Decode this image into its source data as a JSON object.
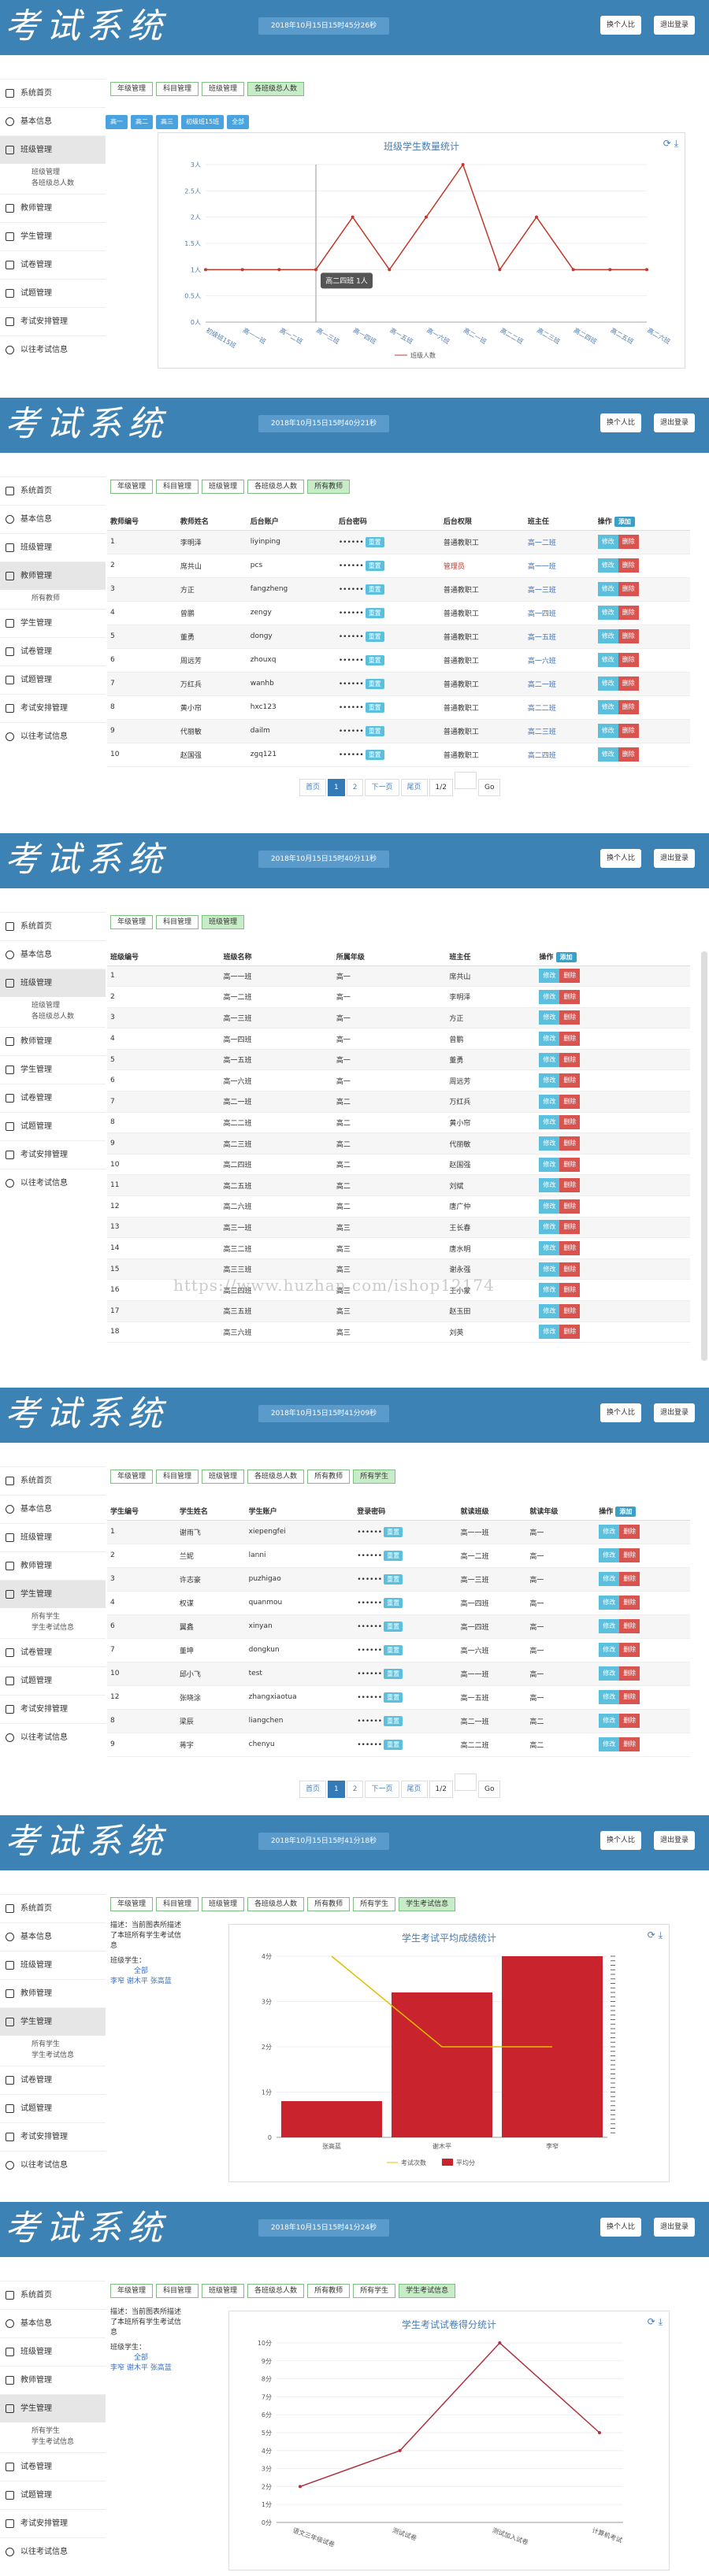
{
  "header": {
    "logo": "考试系统",
    "btn_switch": "换个人比",
    "btn_logout": "退出登录"
  },
  "dates": [
    "2018年10月15日15时45分26秒",
    "2018年10月15日15时40分21秒",
    "2018年10月15日15时40分11秒",
    "2018年10月15日15时41分09秒",
    "2018年10月15日15时41分18秒",
    "2018年10月15日15时41分24秒"
  ],
  "nav": [
    "系统首页",
    "基本信息",
    "班级管理",
    "教师管理",
    "学生管理",
    "试卷管理",
    "试题管理",
    "考试安排管理",
    "以往考试信息"
  ],
  "sub": {
    "class": [
      "班级管理",
      "各班级总人数"
    ],
    "teacher": [
      "所有教师"
    ],
    "student": [
      "所有学生",
      "学生考试信息"
    ]
  },
  "tabs": {
    "p1": [
      "年级管理",
      "科目管理",
      "班级管理",
      "各班级总人数"
    ],
    "p2": [
      "年级管理",
      "科目管理",
      "班级管理",
      "各班级总人数",
      "所有教师"
    ],
    "p3": [
      "年级管理",
      "科目管理",
      "班级管理"
    ],
    "p4": [
      "年级管理",
      "科目管理",
      "班级管理",
      "各班级总人数",
      "所有教师",
      "所有学生"
    ],
    "p5": [
      "年级管理",
      "科目管理",
      "班级管理",
      "各班级总人数",
      "所有教师",
      "所有学生",
      "学生考试信息"
    ]
  },
  "p1": {
    "subtabs": [
      "高一",
      "高二",
      "高三",
      "初级班15班",
      "全部"
    ],
    "tooltip": "高二四班 1人"
  },
  "actions": {
    "add": "添加",
    "edit": "修改",
    "del": "删除",
    "reset": "重置",
    "dots": "••••••"
  },
  "teachers": {
    "headers": [
      "教师编号",
      "教师姓名",
      "后台账户",
      "后台密码",
      "后台权限",
      "班主任",
      "操作"
    ],
    "rows": [
      [
        "1",
        "李明泽",
        "liyinping",
        "普通教职工",
        "高一二班"
      ],
      [
        "2",
        "席共山",
        "pcs",
        "管理员",
        "高一一班"
      ],
      [
        "3",
        "方正",
        "fangzheng",
        "普通教职工",
        "高一三班"
      ],
      [
        "4",
        "曾鹏",
        "zengy",
        "普通教职工",
        "高一四班"
      ],
      [
        "5",
        "董勇",
        "dongy",
        "普通教职工",
        "高一五班"
      ],
      [
        "6",
        "周远芳",
        "zhouxq",
        "普通教职工",
        "高一六班"
      ],
      [
        "7",
        "万红兵",
        "wanhb",
        "普通教职工",
        "高二一班"
      ],
      [
        "8",
        "黄小帘",
        "hxc123",
        "普通教职工",
        "高二二班"
      ],
      [
        "9",
        "代丽敏",
        "dailm",
        "普通教职工",
        "高二三班"
      ],
      [
        "10",
        "赵国强",
        "zgq121",
        "普通教职工",
        "高二四班"
      ]
    ]
  },
  "pager": {
    "first": "首页",
    "p1": "1",
    "p2": "2",
    "next": "下一页",
    "last": "尾页",
    "count": "1/2",
    "go": "Go"
  },
  "classes": {
    "headers": [
      "班级编号",
      "班级名称",
      "所属年级",
      "班主任",
      "操作"
    ],
    "rows": [
      [
        "1",
        "高一一班",
        "高一",
        "席共山"
      ],
      [
        "2",
        "高一二班",
        "高一",
        "李明泽"
      ],
      [
        "3",
        "高一三班",
        "高一",
        "方正"
      ],
      [
        "4",
        "高一四班",
        "高一",
        "曾鹏"
      ],
      [
        "5",
        "高一五班",
        "高一",
        "董勇"
      ],
      [
        "6",
        "高一六班",
        "高一",
        "周远芳"
      ],
      [
        "7",
        "高二一班",
        "高二",
        "万红兵"
      ],
      [
        "8",
        "高二二班",
        "高二",
        "黄小帘"
      ],
      [
        "9",
        "高二三班",
        "高二",
        "代丽敏"
      ],
      [
        "10",
        "高二四班",
        "高二",
        "赵国强"
      ],
      [
        "11",
        "高二五班",
        "高二",
        "刘斌"
      ],
      [
        "12",
        "高二六班",
        "高二",
        "唐广仲"
      ],
      [
        "13",
        "高三一班",
        "高三",
        "王长春"
      ],
      [
        "14",
        "高三二班",
        "高三",
        "唐水明"
      ],
      [
        "15",
        "高三三班",
        "高三",
        "谢永强"
      ],
      [
        "16",
        "高三四班",
        "高三",
        "王小蒙"
      ],
      [
        "17",
        "高三五班",
        "高三",
        "赵玉田"
      ],
      [
        "18",
        "高三六班",
        "高三",
        "刘英"
      ]
    ]
  },
  "students": {
    "headers": [
      "学生编号",
      "学生姓名",
      "学生账户",
      "登录密码",
      "就读班级",
      "就读年级",
      "操作"
    ],
    "rows": [
      [
        "1",
        "谢雨飞",
        "xiepengfei",
        "高一一班",
        "高一"
      ],
      [
        "2",
        "兰妮",
        "lanni",
        "高一二班",
        "高一"
      ],
      [
        "3",
        "许志豪",
        "puzhigao",
        "高一三班",
        "高一"
      ],
      [
        "4",
        "权谋",
        "quanmou",
        "高一四班",
        "高一"
      ],
      [
        "6",
        "翼鑫",
        "xinyan",
        "高一四班",
        "高一"
      ],
      [
        "7",
        "董坤",
        "dongkun",
        "高一六班",
        "高一"
      ],
      [
        "10",
        "邱小飞",
        "test",
        "高一一班",
        "高一"
      ],
      [
        "12",
        "张晓涂",
        "zhangxiaotua",
        "高一五班",
        "高一"
      ],
      [
        "8",
        "梁辰",
        "liangchen",
        "高二一班",
        "高二"
      ],
      [
        "9",
        "蒋宇",
        "chenyu",
        "高二二班",
        "高二"
      ]
    ]
  },
  "exam_info": {
    "desc": "描述：当前图表所描述了本班所有学生考试信息",
    "cls_label": "班级学生：",
    "all": "全部",
    "names": [
      "李窄",
      "谢木平",
      "张高蓝"
    ]
  },
  "watermark": "https://www.huzhan.com/ishop12174",
  "chart_data": [
    {
      "type": "line",
      "title": "班级学生数量统计",
      "legend": "班级人数",
      "categories": [
        "初级班15班",
        "高一一班",
        "高一二班",
        "高一三班",
        "高一四班",
        "高一五班",
        "高一六班",
        "高二一班",
        "高二二班",
        "高二三班",
        "高二四班",
        "高二五班",
        "高二六班"
      ],
      "values": [
        1,
        1,
        1,
        1,
        2,
        1,
        2,
        3,
        1,
        2,
        1,
        1,
        1
      ],
      "yticks": [
        "0人",
        "0.5人",
        "1人",
        "1.5人",
        "2人",
        "2.5人",
        "3人"
      ],
      "ylim": [
        0,
        3
      ]
    },
    {
      "type": "bar",
      "title": "学生考试平均成绩统计",
      "categories": [
        "张高蓝",
        "谢木平",
        "李窄"
      ],
      "values": [
        0.8,
        3.2,
        4
      ],
      "line_values": [
        4,
        2,
        2
      ],
      "legend": [
        "考试次数",
        "平均分"
      ],
      "yticks": [
        "0",
        "1分",
        "2分",
        "3分",
        "4分"
      ],
      "ylim": [
        0,
        4
      ]
    },
    {
      "type": "line",
      "title": "学生考试试卷得分统计",
      "categories": [
        "语文三年级试卷",
        "测试试卷",
        "测试加入试卷",
        "计算机考试"
      ],
      "values": [
        2,
        4,
        10,
        5
      ],
      "yticks": [
        "0分",
        "1分",
        "2分",
        "3分",
        "4分",
        "5分",
        "6分",
        "7分",
        "8分",
        "9分",
        "10分"
      ],
      "ylim": [
        0,
        10
      ]
    }
  ]
}
